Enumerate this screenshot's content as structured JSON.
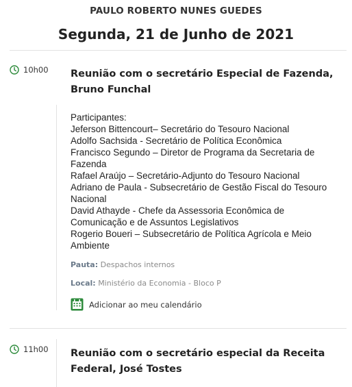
{
  "header": {
    "person": "PAULO ROBERTO NUNES GUEDES",
    "date": "Segunda, 21 de Junho de 2021"
  },
  "events": [
    {
      "time": "10h00",
      "title_line1": "Reunião com o secretário Especial de Fazenda,",
      "title_line2": "Bruno Funchal",
      "participants_label": "Participantes:",
      "participants": [
        "Jeferson Bittencourt– Secretário do Tesouro Nacional",
        "Adolfo Sachsida - Secretário de Política Econômica",
        "Francisco Segundo – Diretor de Programa da Secretaria de",
        "Fazenda",
        "Rafael Araújo – Secretário-Adjunto do Tesouro Nacional",
        "Adriano de Paula - Subsecretário de Gestão Fiscal do Tesouro",
        "Nacional",
        "David Athayde - Chefe da Assessoria Econômica de",
        "Comunicação e de Assuntos Legislativos",
        "Rogerio Boueri – Subsecretário de Política Agrícola e Meio",
        "Ambiente"
      ],
      "pauta_label": "Pauta:",
      "pauta": "Despachos internos",
      "local_label": "Local:",
      "local": "Ministério da Economia - Bloco P",
      "calendar_label": "Adicionar ao meu calendário"
    },
    {
      "time": "11h00",
      "title_line1": "Reunião com o secretário especial da Receita",
      "title_line2": "Federal, José Tostes"
    }
  ],
  "colors": {
    "accent_green": "#2e8b3c",
    "separator": "#e2e2e2"
  },
  "icons": [
    "clock-icon",
    "calendar-icon"
  ]
}
